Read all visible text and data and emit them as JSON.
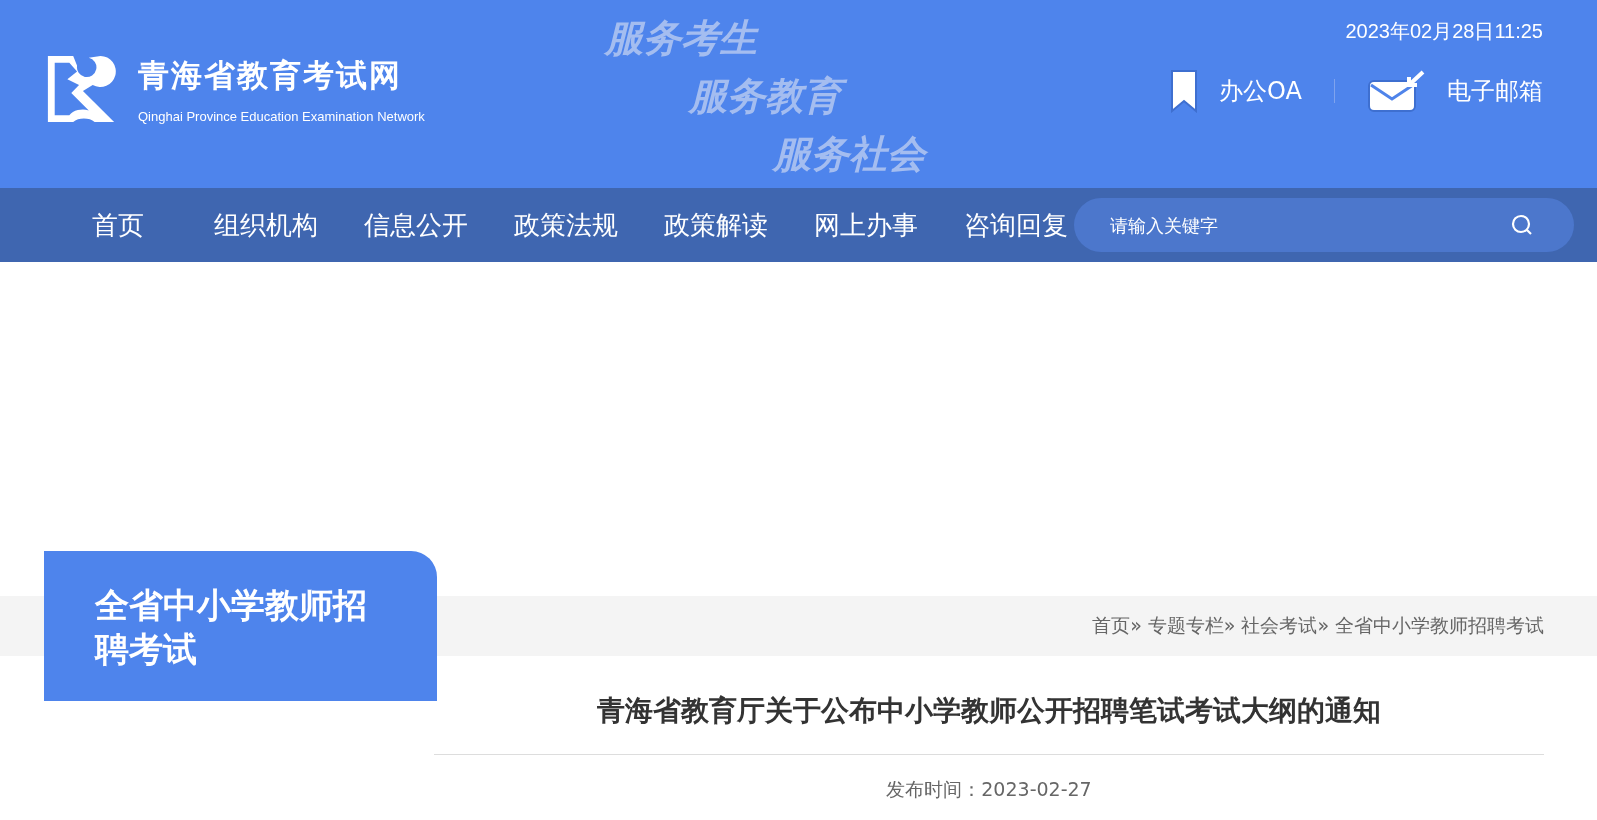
{
  "header": {
    "site_title": "青海省教育考试网",
    "site_subtitle": "Qinghai Province Education Examination Network",
    "slogans": [
      "服务考生",
      "服务教育",
      "服务社会"
    ],
    "datetime": "2023年02月28日11:25",
    "links": [
      {
        "kind": "bookmark",
        "label": "办公OA"
      },
      {
        "kind": "mail",
        "label": "电子邮箱"
      }
    ]
  },
  "nav": {
    "items": [
      {
        "label": "首页"
      },
      {
        "label": "组织机构"
      },
      {
        "label": "信息公开"
      },
      {
        "label": "政策法规"
      },
      {
        "label": "政策解读"
      },
      {
        "label": "网上办事"
      },
      {
        "label": "咨询回复"
      }
    ],
    "search": {
      "placeholder": "请输入关键字"
    }
  },
  "section": {
    "title": "全省中小学教师招聘考试"
  },
  "breadcrumb": [
    "首页»",
    "专题专栏»",
    "社会考试»",
    "全省中小学教师招聘考试"
  ],
  "article": {
    "title": "青海省教育厅关于公布中小学教师公开招聘笔试考试大纲的通知",
    "published": "发布时间：2023-02-27"
  }
}
